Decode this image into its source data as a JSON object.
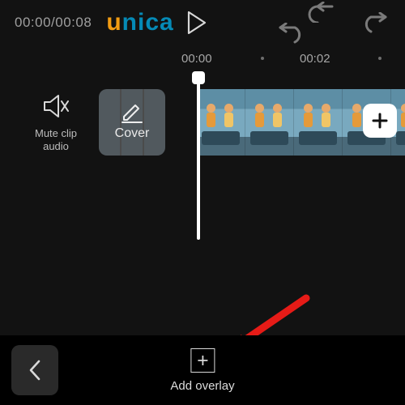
{
  "top": {
    "timecode": "00:00/00:08",
    "logo": {
      "u": "u",
      "ni": "ni",
      "c": "c",
      "a": "a"
    }
  },
  "ruler": {
    "t0": "00:00",
    "t1": "00:02"
  },
  "controls": {
    "mute_label": "Mute clip audio",
    "cover_label": "Cover"
  },
  "bottom": {
    "add_overlay_label": "Add overlay"
  }
}
